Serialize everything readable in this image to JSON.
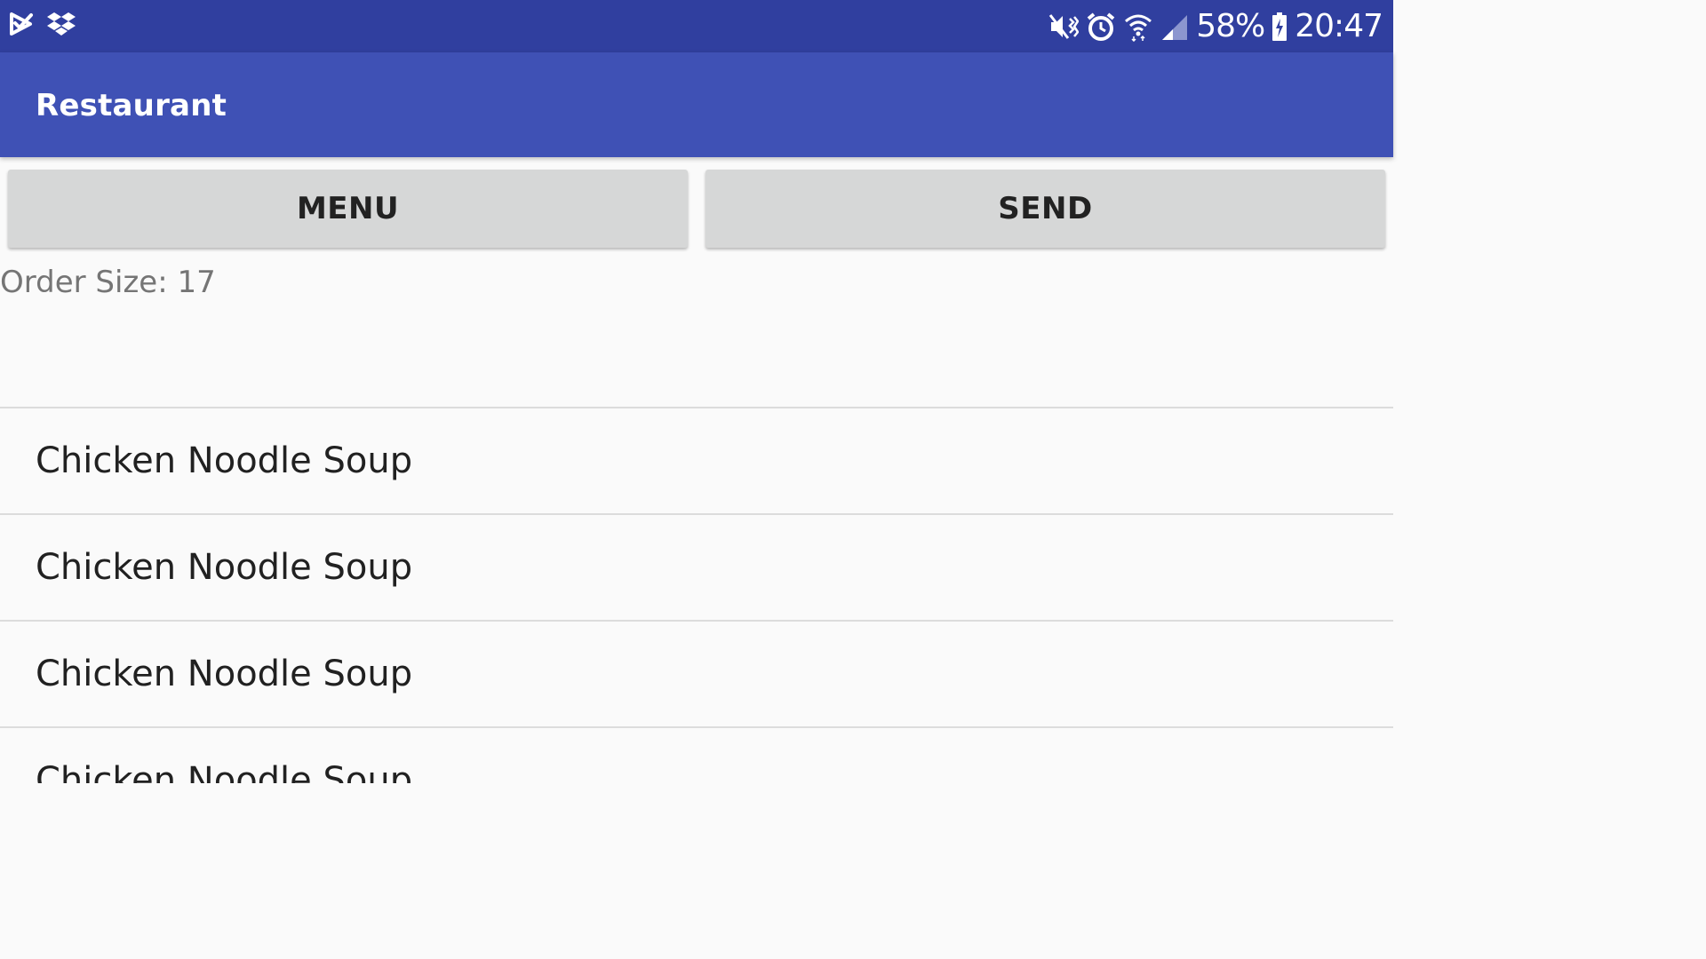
{
  "status_bar": {
    "left_icons": [
      "checkmark-app-icon",
      "dropbox-icon"
    ],
    "right_icons": [
      "mute-vibrate-icon",
      "alarm-icon",
      "wifi-icon",
      "signal-icon",
      "battery-charging-icon"
    ],
    "battery": "58%",
    "time": "20:47",
    "background_color": "#303f9f"
  },
  "app_bar": {
    "title": "Restaurant",
    "background_color": "#3f51b5"
  },
  "buttons": {
    "menu_label": "MENU",
    "send_label": "SEND"
  },
  "order_size_text": "Order Size: 17",
  "order_items": [
    "Chicken Noodle Soup",
    "Chicken Noodle Soup",
    "Chicken Noodle Soup",
    "Chicken Noodle Soup"
  ]
}
